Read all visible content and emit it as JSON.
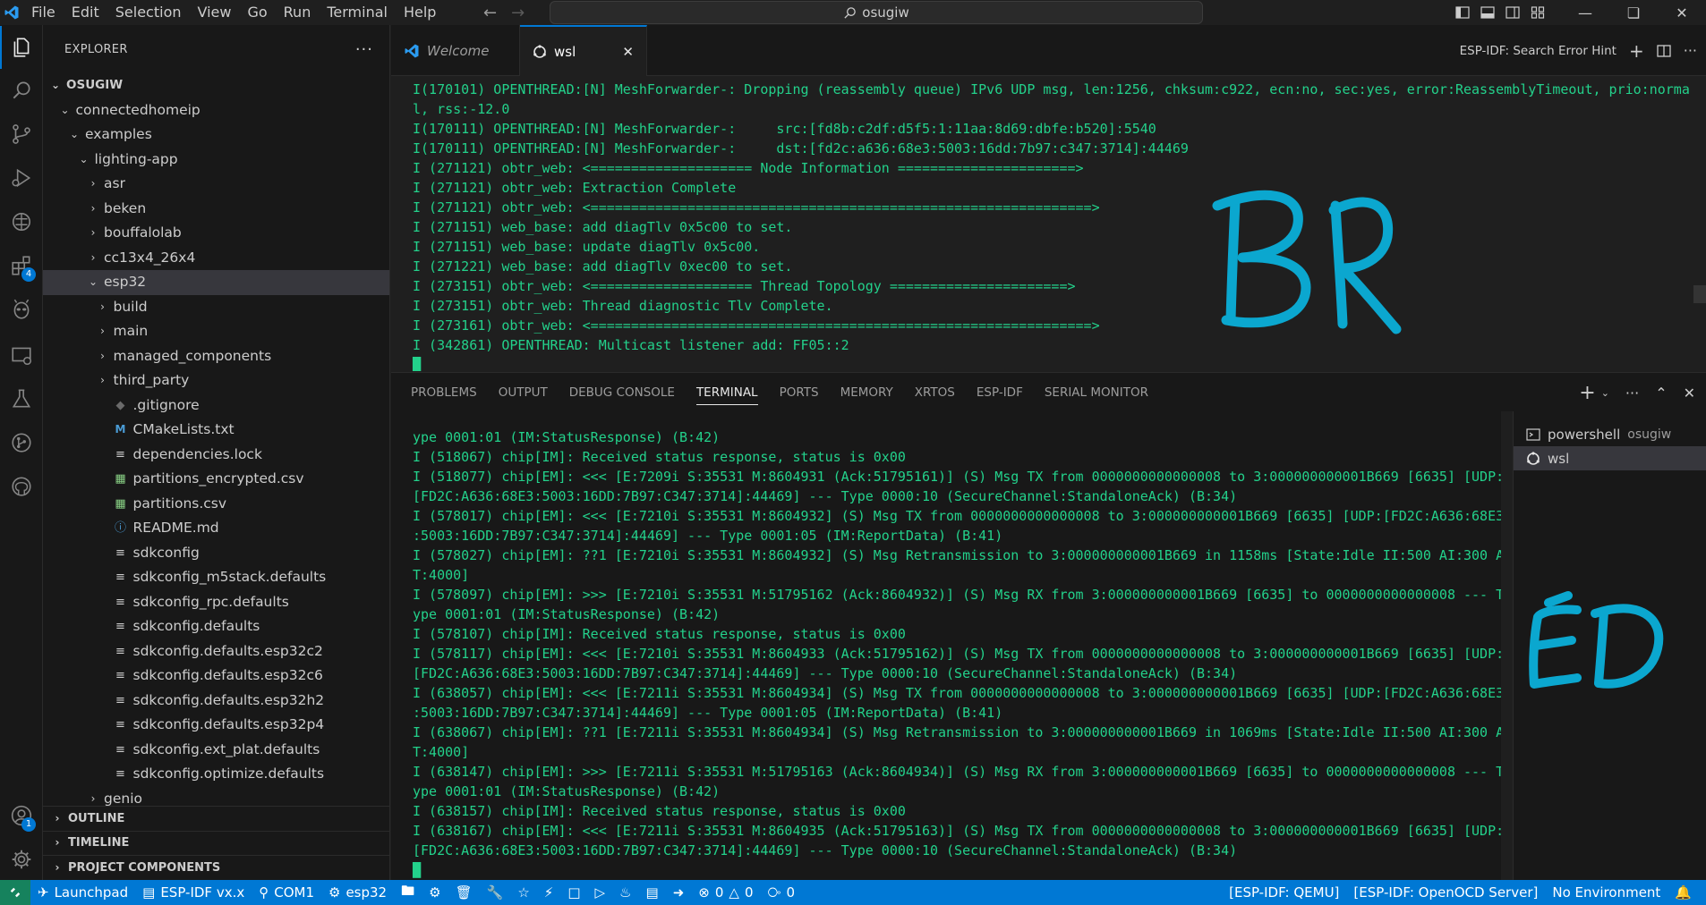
{
  "menu": [
    "File",
    "Edit",
    "Selection",
    "View",
    "Go",
    "Run",
    "Terminal",
    "Help"
  ],
  "command_center": {
    "label": "osugiw"
  },
  "explorer": {
    "title": "EXPLORER",
    "root": "OSUGIW",
    "tree": [
      {
        "label": "connectedhomeip",
        "depth": 1,
        "kind": "folder-open"
      },
      {
        "label": "examples",
        "depth": 2,
        "kind": "folder-open"
      },
      {
        "label": "lighting-app",
        "depth": 3,
        "kind": "folder-open"
      },
      {
        "label": "asr",
        "depth": 4,
        "kind": "folder"
      },
      {
        "label": "beken",
        "depth": 4,
        "kind": "folder"
      },
      {
        "label": "bouffalolab",
        "depth": 4,
        "kind": "folder"
      },
      {
        "label": "cc13x4_26x4",
        "depth": 4,
        "kind": "folder"
      },
      {
        "label": "esp32",
        "depth": 4,
        "kind": "folder-open",
        "selected": true
      },
      {
        "label": "build",
        "depth": 5,
        "kind": "folder"
      },
      {
        "label": "main",
        "depth": 5,
        "kind": "folder"
      },
      {
        "label": "managed_components",
        "depth": 5,
        "kind": "folder"
      },
      {
        "label": "third_party",
        "depth": 5,
        "kind": "folder"
      },
      {
        "label": ".gitignore",
        "depth": 5,
        "kind": "file",
        "icon": "git-icon"
      },
      {
        "label": "CMakeLists.txt",
        "depth": 5,
        "kind": "file",
        "icon": "cmake-icon"
      },
      {
        "label": "dependencies.lock",
        "depth": 5,
        "kind": "file",
        "icon": "lines-icon"
      },
      {
        "label": "partitions_encrypted.csv",
        "depth": 5,
        "kind": "file",
        "icon": "csv-icon"
      },
      {
        "label": "partitions.csv",
        "depth": 5,
        "kind": "file",
        "icon": "csv-icon"
      },
      {
        "label": "README.md",
        "depth": 5,
        "kind": "file",
        "icon": "info-icon"
      },
      {
        "label": "sdkconfig",
        "depth": 5,
        "kind": "file",
        "icon": "lines-icon"
      },
      {
        "label": "sdkconfig_m5stack.defaults",
        "depth": 5,
        "kind": "file",
        "icon": "lines-icon"
      },
      {
        "label": "sdkconfig_rpc.defaults",
        "depth": 5,
        "kind": "file",
        "icon": "lines-icon"
      },
      {
        "label": "sdkconfig.defaults",
        "depth": 5,
        "kind": "file",
        "icon": "lines-icon"
      },
      {
        "label": "sdkconfig.defaults.esp32c2",
        "depth": 5,
        "kind": "file",
        "icon": "lines-icon"
      },
      {
        "label": "sdkconfig.defaults.esp32c6",
        "depth": 5,
        "kind": "file",
        "icon": "lines-icon"
      },
      {
        "label": "sdkconfig.defaults.esp32h2",
        "depth": 5,
        "kind": "file",
        "icon": "lines-icon"
      },
      {
        "label": "sdkconfig.defaults.esp32p4",
        "depth": 5,
        "kind": "file",
        "icon": "lines-icon"
      },
      {
        "label": "sdkconfig.ext_plat.defaults",
        "depth": 5,
        "kind": "file",
        "icon": "lines-icon"
      },
      {
        "label": "sdkconfig.optimize.defaults",
        "depth": 5,
        "kind": "file",
        "icon": "lines-icon"
      },
      {
        "label": "genio",
        "depth": 4,
        "kind": "folder"
      }
    ],
    "sections": [
      "OUTLINE",
      "TIMELINE",
      "PROJECT COMPONENTS"
    ]
  },
  "activity_badges": {
    "extensions": "4",
    "accounts": "1"
  },
  "tabs": [
    {
      "label": "Welcome",
      "icon": "vscode-icon",
      "active": false
    },
    {
      "label": "wsl",
      "icon": "linux-icon",
      "active": true
    }
  ],
  "editor_actions": {
    "hint": "ESP-IDF: Search Error Hint"
  },
  "editor_lines": [
    "I(170101) OPENTHREAD:[N] MeshForwarder-: Dropping (reassembly queue) IPv6 UDP msg, len:1256, chksum:c922, ecn:no, sec:yes, error:ReassemblyTimeout, prio:norma",
    "l, rss:-12.0",
    "I(170111) OPENTHREAD:[N] MeshForwarder-:     src:[fd8b:c2df:d5f5:1:11aa:8d69:dbfe:b520]:5540",
    "I(170111) OPENTHREAD:[N] MeshForwarder-:     dst:[fd2c:a636:68e3:5003:16dd:7b97:c347:3714]:44469",
    "I (271121) obtr_web: <==================== Node Information ======================>",
    "I (271121) obtr_web: Extraction Complete",
    "I (271121) obtr_web: <==============================================================>",
    "I (271151) web_base: add diagTlv 0x5c00 to set.",
    "I (271151) web_base: update diagTlv 0x5c00.",
    "I (271221) web_base: add diagTlv 0xec00 to set.",
    "I (273151) obtr_web: <==================== Thread Topology ======================>",
    "I (273151) obtr_web: Thread diagnostic Tlv Complete.",
    "I (273161) obtr_web: <==============================================================>",
    "I (342861) OPENTHREAD: Multicast listener add: FF05::2",
    "█"
  ],
  "panel_tabs": [
    "PROBLEMS",
    "OUTPUT",
    "DEBUG CONSOLE",
    "TERMINAL",
    "PORTS",
    "MEMORY",
    "XRTOS",
    "ESP-IDF",
    "SERIAL MONITOR"
  ],
  "panel_active": "TERMINAL",
  "terminal_lines": [
    "ype 0001:01 (IM:StatusResponse) (B:42)",
    "I (518067) chip[IM]: Received status response, status is 0x00",
    "I (518077) chip[EM]: <<< [E:7209i S:35531 M:8604931 (Ack:51795161)] (S) Msg TX from 0000000000000008 to 3:000000000001B669 [6635] [UDP:",
    "[FD2C:A636:68E3:5003:16DD:7B97:C347:3714]:44469] --- Type 0000:10 (SecureChannel:StandaloneAck) (B:34)",
    "I (578017) chip[EM]: <<< [E:7210i S:35531 M:8604932] (S) Msg TX from 0000000000000008 to 3:000000000001B669 [6635] [UDP:[FD2C:A636:68E3",
    ":5003:16DD:7B97:C347:3714]:44469] --- Type 0001:05 (IM:ReportData) (B:41)",
    "I (578027) chip[EM]: ??1 [E:7210i S:35531 M:8604932] (S) Msg Retransmission to 3:000000000001B669 in 1158ms [State:Idle II:500 AI:300 A",
    "T:4000]",
    "I (578097) chip[EM]: >>> [E:7210i S:35531 M:51795162 (Ack:8604932)] (S) Msg RX from 3:000000000001B669 [6635] to 0000000000000008 --- T",
    "ype 0001:01 (IM:StatusResponse) (B:42)",
    "I (578107) chip[IM]: Received status response, status is 0x00",
    "I (578117) chip[EM]: <<< [E:7210i S:35531 M:8604933 (Ack:51795162)] (S) Msg TX from 0000000000000008 to 3:000000000001B669 [6635] [UDP:",
    "[FD2C:A636:68E3:5003:16DD:7B97:C347:3714]:44469] --- Type 0000:10 (SecureChannel:StandaloneAck) (B:34)",
    "I (638057) chip[EM]: <<< [E:7211i S:35531 M:8604934] (S) Msg TX from 0000000000000008 to 3:000000000001B669 [6635] [UDP:[FD2C:A636:68E3",
    ":5003:16DD:7B97:C347:3714]:44469] --- Type 0001:05 (IM:ReportData) (B:41)",
    "I (638067) chip[EM]: ??1 [E:7211i S:35531 M:8604934] (S) Msg Retransmission to 3:000000000001B669 in 1069ms [State:Idle II:500 AI:300 A",
    "T:4000]",
    "I (638147) chip[EM]: >>> [E:7211i S:35531 M:51795163 (Ack:8604934)] (S) Msg RX from 3:000000000001B669 [6635] to 0000000000000008 --- T",
    "ype 0001:01 (IM:StatusResponse) (B:42)",
    "I (638157) chip[IM]: Received status response, status is 0x00",
    "I (638167) chip[EM]: <<< [E:7211i S:35531 M:8604935 (Ack:51795163)] (S) Msg TX from 0000000000000008 to 3:000000000001B669 [6635] [UDP:",
    "[FD2C:A636:68E3:5003:16DD:7B97:C347:3714]:44469] --- Type 0000:10 (SecureChannel:StandaloneAck) (B:34)",
    "█"
  ],
  "terminal_list": [
    {
      "label": "powershell",
      "sub": "osugiw",
      "icon": "terminal-icon",
      "active": false
    },
    {
      "label": "wsl",
      "sub": "",
      "icon": "linux-icon",
      "active": true
    }
  ],
  "annotations": {
    "editor": "BR",
    "terminal": "ED"
  },
  "statusbar": {
    "launchpad": "Launchpad",
    "idf_version": "ESP-IDF vx.x",
    "port": "COM1",
    "target": "esp32",
    "errors": "0",
    "warnings": "0",
    "ports_count": "0",
    "qemu": "[ESP-IDF: QEMU]",
    "openocd": "[ESP-IDF: OpenOCD Server]",
    "environment": "No Environment"
  },
  "colors": {
    "accent": "#0078d4",
    "terminal_green": "#23d18b",
    "handwriting": "#0ba7cf",
    "remote": "#16825d"
  }
}
